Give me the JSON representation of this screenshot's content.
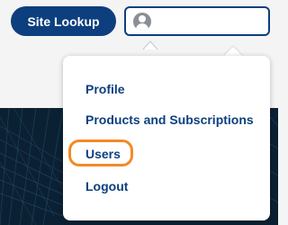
{
  "header": {
    "site_lookup_label": "Site Lookup",
    "account_icon": "user-avatar-icon",
    "caret_icon": "caret-up-icon"
  },
  "account_menu": {
    "items": [
      {
        "label": "Profile"
      },
      {
        "label": "Products and Subscriptions"
      },
      {
        "label": "Users",
        "highlighted": true
      },
      {
        "label": "Logout"
      }
    ]
  },
  "colors": {
    "brand_navy": "#0d3f7e",
    "highlight_orange": "#f28a24",
    "hero_dark": "#0b2133",
    "page_bg": "#f4f4f4"
  }
}
